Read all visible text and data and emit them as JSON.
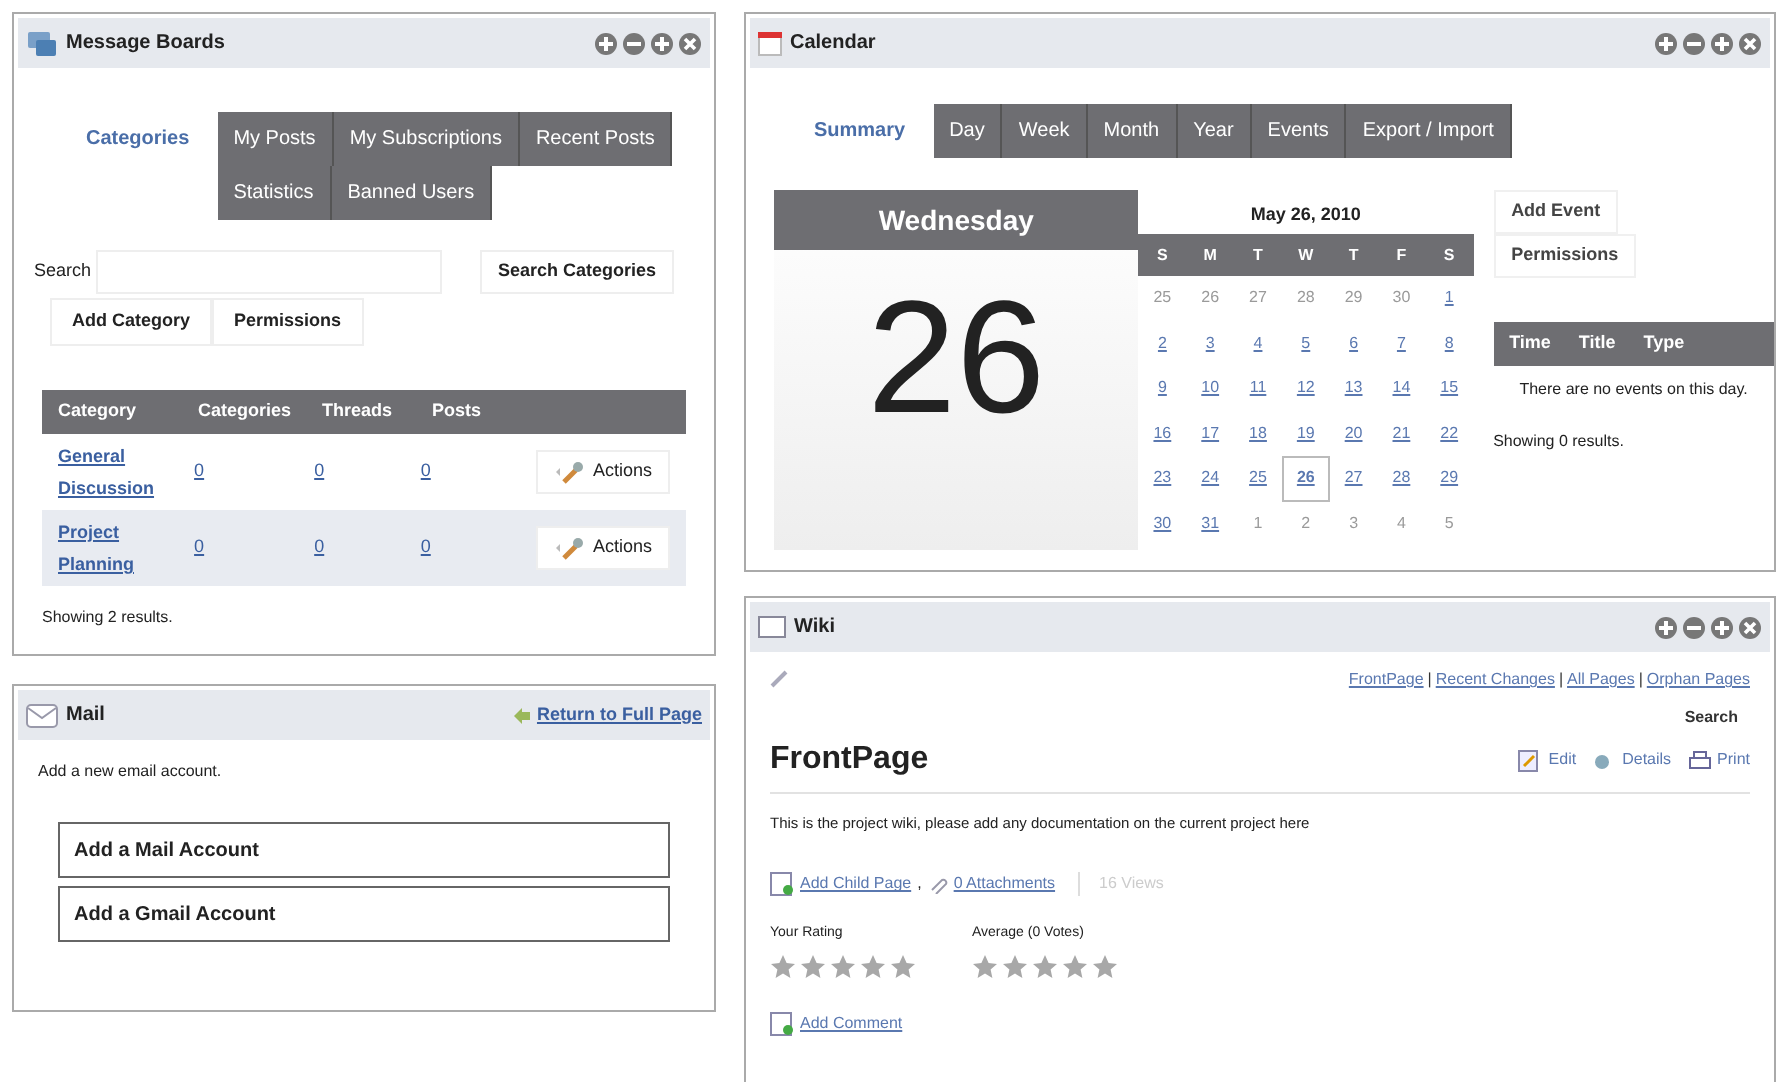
{
  "message_boards": {
    "title": "Message Boards",
    "tabs": [
      {
        "label": "Categories",
        "selected": true
      },
      {
        "label": "My Posts",
        "selected": false
      },
      {
        "label": "My Subscriptions",
        "selected": false
      },
      {
        "label": "Recent Posts",
        "selected": false
      },
      {
        "label": "Statistics",
        "selected": false
      },
      {
        "label": "Banned Users",
        "selected": false
      }
    ],
    "search_label": "Search",
    "search_button": "Search Categories",
    "buttons": [
      "Add Category",
      "Permissions"
    ],
    "table": {
      "columns": [
        "Category",
        "Categories",
        "Threads",
        "Posts"
      ],
      "rows": [
        {
          "category": "General Discussion",
          "categories": "0",
          "threads": "0",
          "posts": "0",
          "action": "Actions",
          "highlighted": false
        },
        {
          "category": "Project Planning",
          "categories": "0",
          "threads": "0",
          "posts": "0",
          "action": "Actions",
          "highlighted": true
        }
      ]
    },
    "status": "Showing 2 results."
  },
  "mail": {
    "title": "Mail",
    "return_link": "Return to Full Page",
    "intro": "Add a new email account.",
    "buttons": [
      "Add a Mail Account",
      "Add a Gmail Account"
    ]
  },
  "calendar": {
    "title": "Calendar",
    "tabs": [
      {
        "label": "Summary",
        "selected": true
      },
      {
        "label": "Day",
        "selected": false
      },
      {
        "label": "Week",
        "selected": false
      },
      {
        "label": "Month",
        "selected": false
      },
      {
        "label": "Year",
        "selected": false
      },
      {
        "label": "Events",
        "selected": false
      },
      {
        "label": "Export / Import",
        "selected": false
      }
    ],
    "weekday": "Wednesday",
    "day": "26",
    "month_title": "May 26, 2010",
    "weekdays": [
      "S",
      "M",
      "T",
      "W",
      "T",
      "F",
      "S"
    ],
    "days": [
      {
        "d": "25",
        "muted": true,
        "selected": false
      },
      {
        "d": "26",
        "muted": true,
        "selected": false
      },
      {
        "d": "27",
        "muted": true,
        "selected": false
      },
      {
        "d": "28",
        "muted": true,
        "selected": false
      },
      {
        "d": "29",
        "muted": true,
        "selected": false
      },
      {
        "d": "30",
        "muted": true,
        "selected": false
      },
      {
        "d": "1",
        "muted": false,
        "selected": false
      },
      {
        "d": "2",
        "muted": false,
        "selected": false
      },
      {
        "d": "3",
        "muted": false,
        "selected": false
      },
      {
        "d": "4",
        "muted": false,
        "selected": false
      },
      {
        "d": "5",
        "muted": false,
        "selected": false
      },
      {
        "d": "6",
        "muted": false,
        "selected": false
      },
      {
        "d": "7",
        "muted": false,
        "selected": false
      },
      {
        "d": "8",
        "muted": false,
        "selected": false
      },
      {
        "d": "9",
        "muted": false,
        "selected": false
      },
      {
        "d": "10",
        "muted": false,
        "selected": false
      },
      {
        "d": "11",
        "muted": false,
        "selected": false
      },
      {
        "d": "12",
        "muted": false,
        "selected": false
      },
      {
        "d": "13",
        "muted": false,
        "selected": false
      },
      {
        "d": "14",
        "muted": false,
        "selected": false
      },
      {
        "d": "15",
        "muted": false,
        "selected": false
      },
      {
        "d": "16",
        "muted": false,
        "selected": false
      },
      {
        "d": "17",
        "muted": false,
        "selected": false
      },
      {
        "d": "18",
        "muted": false,
        "selected": false
      },
      {
        "d": "19",
        "muted": false,
        "selected": false
      },
      {
        "d": "20",
        "muted": false,
        "selected": false
      },
      {
        "d": "21",
        "muted": false,
        "selected": false
      },
      {
        "d": "22",
        "muted": false,
        "selected": false
      },
      {
        "d": "23",
        "muted": false,
        "selected": false
      },
      {
        "d": "24",
        "muted": false,
        "selected": false
      },
      {
        "d": "25",
        "muted": false,
        "selected": false
      },
      {
        "d": "26",
        "muted": false,
        "selected": true
      },
      {
        "d": "27",
        "muted": false,
        "selected": false
      },
      {
        "d": "28",
        "muted": false,
        "selected": false
      },
      {
        "d": "29",
        "muted": false,
        "selected": false
      },
      {
        "d": "30",
        "muted": false,
        "selected": false
      },
      {
        "d": "31",
        "muted": false,
        "selected": false
      },
      {
        "d": "1",
        "muted": true,
        "selected": false
      },
      {
        "d": "2",
        "muted": true,
        "selected": false
      },
      {
        "d": "3",
        "muted": true,
        "selected": false
      },
      {
        "d": "4",
        "muted": true,
        "selected": false
      },
      {
        "d": "5",
        "muted": true,
        "selected": false
      }
    ],
    "buttons": [
      "Add Event",
      "Permissions"
    ],
    "event_columns": [
      "Time",
      "Title",
      "Type"
    ],
    "empty": "There are no events on this day.",
    "status": "Showing 0 results."
  },
  "wiki": {
    "title": "Wiki",
    "nav": [
      "FrontPage",
      "Recent Changes",
      "All Pages",
      "Orphan Pages"
    ],
    "nav_separator": "|",
    "search_button": "Search",
    "page_title": "FrontPage",
    "actions": [
      "Edit",
      "Details",
      "Print"
    ],
    "body": "This is the project wiki, please add any documentation on the current project here",
    "add_child": "Add Child Page",
    "comma": ",",
    "attachments": "0 Attachments",
    "views": "16 Views",
    "ratings": [
      {
        "label": "Your Rating",
        "stars": 0
      },
      {
        "label": "Average (0 Votes)",
        "stars": 0
      }
    ],
    "add_comment": "Add Comment"
  }
}
